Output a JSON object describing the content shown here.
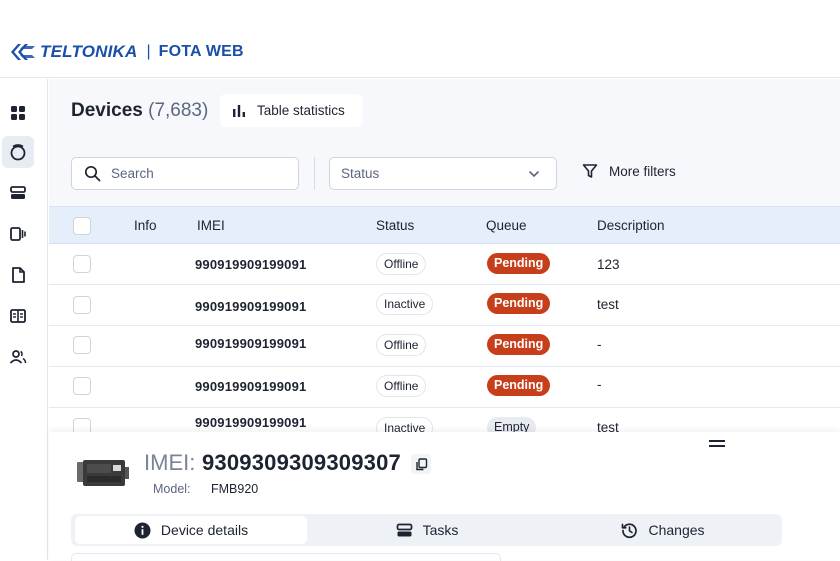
{
  "app": {
    "brand": "TELTONIKA",
    "separator": "|",
    "product": "FOTA WEB",
    "brand_color": "#1a4fa8"
  },
  "sidebar": {
    "items": [
      {
        "icon": "dashboard-icon",
        "active": false
      },
      {
        "icon": "devices-icon",
        "active": true
      },
      {
        "icon": "tasks-icon",
        "active": false
      },
      {
        "icon": "device-groups-icon",
        "active": false
      },
      {
        "icon": "files-icon",
        "active": false
      },
      {
        "icon": "reports-icon",
        "active": false
      },
      {
        "icon": "users-icon",
        "active": false
      }
    ]
  },
  "header": {
    "title": "Devices",
    "count": "(7,683)",
    "stats_button": "Table statistics"
  },
  "filters": {
    "search_placeholder": "Search",
    "status_placeholder": "Status",
    "more_filters": "More filters"
  },
  "table": {
    "columns": [
      "Info",
      "IMEI",
      "Status",
      "Queue",
      "Description"
    ],
    "rows": [
      {
        "imei": "990919909199091",
        "status": "Offline",
        "queue": "Pending",
        "description": "123"
      },
      {
        "imei": "990919909199091",
        "status": "Inactive",
        "queue": "Pending",
        "description": "test"
      },
      {
        "imei": "990919909199091",
        "status": "Offline",
        "queue": "Pending",
        "description": "-"
      },
      {
        "imei": "990919909199091",
        "status": "Offline",
        "queue": "Pending",
        "description": "-"
      },
      {
        "imei": "990919909199091",
        "status": "Inactive",
        "queue": "Empty",
        "description": "test"
      }
    ]
  },
  "details": {
    "imei_label": "IMEI:",
    "imei_value": "9309309309309307",
    "model_label": "Model:",
    "model_value": "FMB920",
    "tabs": [
      "Device details",
      "Tasks",
      "Changes"
    ],
    "active_tab": "Device details"
  },
  "colors": {
    "pending": "#c63f1a",
    "header_row": "#e4effb"
  }
}
